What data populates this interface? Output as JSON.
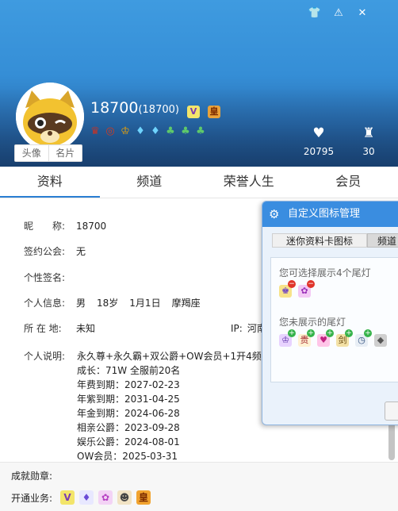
{
  "window": {
    "controls": [
      {
        "icon": "shirt-icon",
        "glyph": "👕"
      },
      {
        "icon": "warning-icon",
        "glyph": "⚠"
      },
      {
        "icon": "close-icon",
        "glyph": "✕"
      }
    ]
  },
  "profile": {
    "name": "18700",
    "qq_number": "(18700)",
    "avatar_tabs": [
      "头像",
      "名片"
    ],
    "likes": "20795",
    "level": "30"
  },
  "tabs": [
    "资料",
    "频道",
    "荣誉人生",
    "会员"
  ],
  "info": {
    "nickname_label": "昵　　称:",
    "nickname": "18700",
    "guild_label": "签约公会:",
    "guild": "无",
    "signature_label": "个性签名:",
    "signature": "",
    "personal_label": "个人信息:",
    "gender": "男",
    "age": "18岁",
    "birthday": "1月1日",
    "zodiac": "摩羯座",
    "location_label": "所 在 地:",
    "location": "未知",
    "ip_label": "IP:",
    "ip": "河南",
    "desc_label": "个人说明:",
    "desc_lines": [
      "永久尊+永久霸+双公爵+OW会员+1开4频",
      "成长：71W 全服前20名",
      "年费到期：2027-02-23",
      "年紫到期：2031-04-25",
      "年金到期：2024-06-28",
      "相亲公爵：2023-09-28",
      "娱乐公爵：2024-08-01",
      "OW会员：2025-03-31"
    ]
  },
  "footer": {
    "medal_label": "成就勋章:",
    "service_label": "开通业务:"
  },
  "popup": {
    "title": "自定义图标管理",
    "tabs": [
      "迷你资料卡图标",
      "频道"
    ],
    "shown_label": "您可选择展示4个尾灯",
    "hidden_label": "您未展示的尾灯"
  }
}
